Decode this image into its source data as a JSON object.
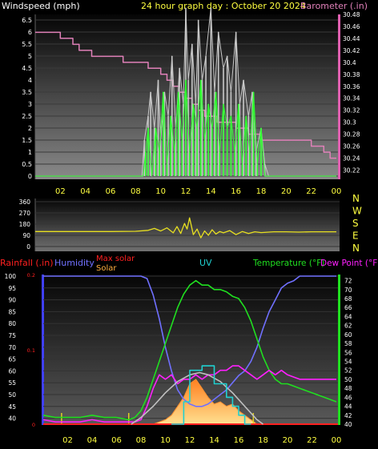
{
  "header": {
    "left_title": "Windspeed (mph)",
    "center_title": "24 hour graph day : October 20 2024",
    "right_title": "Barometer (.in)"
  },
  "colors": {
    "wind": "#c8c8c8",
    "gust": "#30ff30",
    "baro": "#e080b8",
    "winddir": "#e8e020",
    "rain": "#ff2020",
    "humidity": "#7070ff",
    "maxsolar": "#c0c0c0",
    "solar": "#ffb040",
    "uv": "#20d0d0",
    "temp": "#20e020",
    "dew": "#ff20ff",
    "time_axis": "#ffff40",
    "left_axis_bar": "#4040ff",
    "right_axis_bar": "#20e020",
    "baro_axis_bar": "#e060b0"
  },
  "legend": {
    "rainfall": "Rainfall (.in)",
    "humidity": "Humidity",
    "max_solar": "Max solar",
    "solar": "Solar",
    "uv": "UV",
    "temperature": "Temperature (°F)",
    "dew_point": "Dew Point (°F)"
  },
  "compass": [
    "N",
    "W",
    "S",
    "E",
    "N"
  ],
  "chart_data": [
    {
      "type": "line",
      "name": "wind-barometer",
      "x_range": [
        0,
        24
      ],
      "x_ticks": [
        "02",
        "04",
        "06",
        "08",
        "10",
        "12",
        "14",
        "16",
        "18",
        "20",
        "22",
        "00"
      ],
      "y_left_label": "Windspeed (mph)",
      "y_left_range": [
        0,
        7
      ],
      "y_left_ticks": [
        "0",
        "0.5",
        "1",
        "1.5",
        "2",
        "2.5",
        "3",
        "3.5",
        "4",
        "4.5",
        "5",
        "5.5",
        "6",
        "6.5"
      ],
      "y_right_label": "Barometer (.in)",
      "y_right_range": [
        30.21,
        30.48
      ],
      "y_right_ticks": [
        "30.22",
        "30.24",
        "30.26",
        "30.28",
        "30.3",
        "30.32",
        "30.34",
        "30.36",
        "30.38",
        "30.4",
        "30.42",
        "30.44",
        "30.46",
        "30.48"
      ],
      "series": [
        {
          "name": "Barometer",
          "axis": "right",
          "x": [
            0,
            1.5,
            2,
            3,
            3.5,
            4,
            4.5,
            5,
            6,
            7,
            8,
            9,
            9.5,
            10,
            10.5,
            11,
            11.5,
            12,
            12.5,
            13,
            13.5,
            14,
            14.5,
            15,
            16,
            17,
            18,
            19,
            20,
            21,
            22,
            22.5,
            23,
            23.5,
            24
          ],
          "y": [
            30.45,
            30.45,
            30.44,
            30.43,
            30.42,
            30.42,
            30.41,
            30.41,
            30.41,
            30.4,
            30.4,
            30.39,
            30.39,
            30.38,
            30.37,
            30.36,
            30.35,
            30.34,
            30.33,
            30.32,
            30.31,
            30.31,
            30.3,
            30.3,
            30.29,
            30.28,
            30.27,
            30.27,
            30.27,
            30.27,
            30.26,
            30.26,
            30.25,
            30.24,
            30.24
          ]
        },
        {
          "name": "Windspeed",
          "axis": "left",
          "x": [
            0,
            8.5,
            8.7,
            9,
            9.2,
            9.5,
            9.8,
            10,
            10.3,
            10.6,
            10.9,
            11.2,
            11.5,
            11.8,
            12,
            12.2,
            12.5,
            12.8,
            13,
            13.3,
            13.6,
            14,
            14.3,
            14.6,
            15,
            15.3,
            15.6,
            16,
            16.3,
            16.6,
            17,
            17.3,
            17.6,
            18,
            18.3,
            18.6,
            19,
            24
          ],
          "y": [
            0,
            0,
            1.5,
            2.5,
            3.5,
            2,
            4,
            1.5,
            3.5,
            2.5,
            5,
            2,
            4.5,
            3,
            7,
            4,
            5.5,
            3,
            6.5,
            4,
            5,
            7,
            3.5,
            6,
            4.5,
            5,
            3.5,
            6,
            3,
            4,
            2.5,
            3.5,
            1,
            2,
            0.5,
            0,
            0,
            0
          ]
        },
        {
          "name": "Gust",
          "axis": "left",
          "x": [
            0,
            8.6,
            8.8,
            9,
            9.3,
            9.6,
            9.9,
            10.2,
            10.5,
            10.8,
            11.1,
            11.4,
            11.7,
            12,
            12.3,
            12.6,
            12.9,
            13.2,
            13.5,
            13.8,
            14.1,
            14.4,
            14.7,
            15,
            15.3,
            15.6,
            15.9,
            16.2,
            16.5,
            16.8,
            17.1,
            17.4,
            17.7,
            18,
            18.3,
            18.6,
            24
          ],
          "y": [
            0,
            0,
            1,
            2,
            0,
            2,
            1,
            3.5,
            0.5,
            2.5,
            1,
            3.5,
            1.5,
            4,
            1,
            3,
            2,
            4,
            1.5,
            3,
            2,
            3.5,
            1,
            3,
            2,
            2.5,
            1,
            3,
            0.5,
            2.5,
            1,
            3.5,
            0.5,
            2,
            0,
            0,
            0
          ]
        }
      ]
    },
    {
      "type": "line",
      "name": "wind-direction",
      "x_range": [
        0,
        24
      ],
      "y_range": [
        0,
        360
      ],
      "y_ticks": [
        "0",
        "90",
        "180",
        "270",
        "360"
      ],
      "series": [
        {
          "name": "Wind direction",
          "x": [
            0,
            6,
            8,
            9,
            9.5,
            10,
            10.5,
            11,
            11.3,
            11.6,
            11.9,
            12.1,
            12.3,
            12.6,
            12.9,
            13.2,
            13.5,
            13.8,
            14.1,
            14.4,
            14.7,
            15,
            15.5,
            16,
            16.5,
            17,
            17.5,
            18,
            19,
            20,
            21,
            22,
            23,
            24
          ],
          "y": [
            120,
            120,
            122,
            130,
            145,
            125,
            150,
            110,
            160,
            105,
            185,
            140,
            230,
            95,
            140,
            70,
            125,
            90,
            135,
            100,
            120,
            110,
            128,
            95,
            120,
            105,
            118,
            112,
            118,
            118,
            116,
            118,
            118,
            118
          ]
        }
      ]
    },
    {
      "type": "line",
      "name": "temp-humidity-solar",
      "x_range": [
        0,
        24
      ],
      "x_ticks": [
        "02",
        "04",
        "06",
        "08",
        "10",
        "12",
        "14",
        "16",
        "18",
        "20",
        "22",
        "00"
      ],
      "y_left_ticks": [
        "40",
        "45",
        "50",
        "55",
        "60",
        "65",
        "70",
        "75",
        "80",
        "85",
        "90",
        "95",
        "100"
      ],
      "y_left_range": [
        37.5,
        100
      ],
      "rain_ticks": [
        "0",
        "0.1",
        "0.2"
      ],
      "y_right_ticks": [
        "40",
        "42",
        "44",
        "46",
        "48",
        "50",
        "52",
        "54",
        "56",
        "58",
        "60",
        "62",
        "64",
        "66",
        "68",
        "70",
        "72"
      ],
      "y_right_range": [
        40,
        73
      ],
      "series": [
        {
          "name": "Humidity",
          "axis": "left",
          "x": [
            0,
            8,
            8.5,
            9,
            9.5,
            10,
            10.5,
            11,
            11.5,
            12,
            12.5,
            13,
            13.5,
            14,
            14.5,
            15,
            15.5,
            16,
            16.5,
            17,
            17.5,
            18,
            18.5,
            19,
            19.5,
            20,
            20.5,
            21,
            22,
            23,
            24
          ],
          "y": [
            100,
            100,
            99,
            92,
            82,
            70,
            60,
            52,
            48,
            46,
            45,
            45,
            46,
            48,
            50,
            52,
            55,
            58,
            60,
            64,
            70,
            78,
            85,
            90,
            95,
            97,
            98,
            100,
            100,
            100,
            100
          ]
        },
        {
          "name": "Temperature",
          "axis": "right",
          "x": [
            0,
            1,
            2,
            3,
            4,
            5,
            6,
            7,
            7.5,
            8,
            8.5,
            9,
            9.5,
            10,
            10.5,
            11,
            11.5,
            12,
            12.5,
            13,
            13.5,
            14,
            14.5,
            15,
            15.5,
            16,
            16.5,
            17,
            17.5,
            18,
            18.5,
            19,
            19.5,
            20,
            21,
            22,
            23,
            24
          ],
          "y": [
            42,
            41.5,
            41.5,
            41.5,
            42,
            41.5,
            41.5,
            41,
            41.5,
            43,
            46,
            50,
            54,
            58,
            62,
            66,
            69,
            71,
            72,
            71,
            71,
            70,
            70,
            69.5,
            68.5,
            68,
            66,
            63,
            59,
            55,
            52,
            50,
            49,
            49,
            48,
            47,
            46,
            45
          ]
        },
        {
          "name": "Dew Point",
          "axis": "right",
          "x": [
            0,
            1,
            2,
            3,
            4,
            5,
            6,
            7,
            7.5,
            8,
            8.5,
            9,
            9.5,
            10,
            10.5,
            11,
            11.5,
            12,
            12.5,
            13,
            13.5,
            14,
            14.5,
            15,
            15.5,
            16,
            16.5,
            17,
            17.5,
            18,
            18.5,
            19,
            19.5,
            20,
            21,
            22,
            23,
            24
          ],
          "y": [
            41,
            40.5,
            40.5,
            40.5,
            41,
            40.5,
            40.5,
            40.5,
            40.5,
            41,
            44,
            48,
            51,
            50,
            51,
            49,
            50,
            50,
            51,
            50,
            51,
            51,
            52,
            52,
            53,
            53,
            52,
            51,
            50,
            51,
            52,
            51,
            52,
            51,
            50,
            50,
            50,
            50
          ]
        },
        {
          "name": "Max solar",
          "axis": "right",
          "x": [
            7.2,
            8,
            9,
            10,
            11,
            12,
            12.8,
            13.5,
            14.5,
            15.5,
            16.5,
            17.5,
            18
          ],
          "y": [
            40,
            41.5,
            44,
            47,
            49.5,
            51,
            51.5,
            51,
            49.5,
            47,
            44,
            41,
            40
          ]
        },
        {
          "name": "UV",
          "axis": "right",
          "x": [
            10.5,
            11,
            11.5,
            11.5,
            12,
            12,
            13,
            13,
            14,
            14,
            15,
            15,
            15.5,
            15.5,
            16,
            16,
            16.5,
            16.5,
            17
          ],
          "y": [
            40,
            40,
            40,
            45,
            45,
            52,
            52,
            53,
            53,
            49,
            49,
            46,
            46,
            44,
            44,
            42,
            42,
            40,
            40
          ]
        }
      ],
      "solar_area": {
        "x": [
          9,
          9.5,
          10,
          10.5,
          11,
          11.5,
          12,
          12.5,
          13,
          13.5,
          14,
          14.5,
          15,
          15.5,
          16,
          16.5,
          17,
          17.5
        ],
        "y": [
          40,
          40.5,
          41,
          42,
          44,
          46,
          49,
          50,
          48,
          46,
          44.5,
          45,
          44,
          44.5,
          43,
          42,
          41,
          40
        ]
      },
      "rain_markers_x": [
        1.5,
        7,
        17.2
      ]
    }
  ]
}
